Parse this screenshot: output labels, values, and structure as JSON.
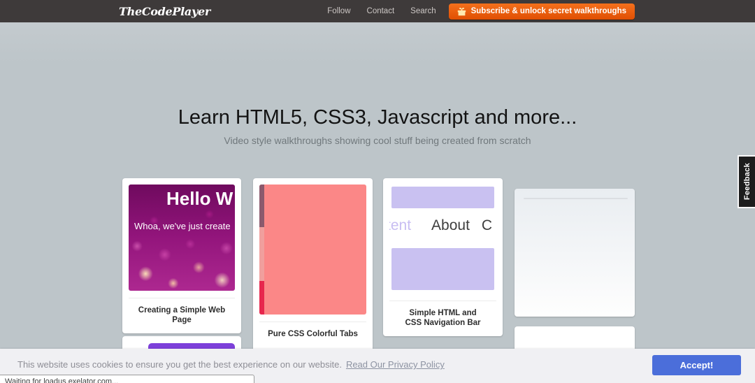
{
  "navbar": {
    "logo": "TheCodePlayer",
    "links": [
      {
        "label": "Follow"
      },
      {
        "label": "Contact"
      },
      {
        "label": "Search"
      }
    ],
    "subscribe_button": {
      "label": "Subscribe & unlock secret walkthroughs",
      "icon": "gift-icon",
      "color": "#ef5714"
    }
  },
  "hero": {
    "title": "Learn HTML5, CSS3, Javascript and more...",
    "subtitle": "Video style walkthroughs showing cool stuff being created from scratch"
  },
  "cards": [
    {
      "title": "Creating a Simple Web Page",
      "preview": {
        "heading": "Hello W",
        "subtext": "Whoa, we've just create"
      }
    },
    {
      "title": "Pure CSS Colorful Tabs",
      "preview": {
        "colors": {
          "main": "#fb8787",
          "strip_top": "#8b5a6d",
          "strip_mid": "#f09f9d",
          "strip_bottom": "#e7274e"
        }
      }
    },
    {
      "title": "Simple HTML and CSS Navigation Bar",
      "preview": {
        "nav_items": [
          "tent",
          "About",
          "C"
        ],
        "bar_color": "#c9c1f1"
      }
    },
    {
      "title": ""
    }
  ],
  "partial_cards": {
    "purple_bar_color": "#7d40da"
  },
  "feedback_tab": {
    "label": "Feedback"
  },
  "cookie_bar": {
    "message": "This website uses cookies to ensure you get the best experience on our website.",
    "link_label": "Read Our Privacy Policy",
    "accept_label": "Accept!",
    "accent_color": "#4b6eda"
  },
  "status_bar": {
    "text": "Waiting for loadus.exelator.com..."
  },
  "colors": {
    "navbar_bg": "#3e3a3a",
    "page_bg": "#bdc5c9",
    "subscribe_orange": "#ef5714",
    "accept_blue": "#4b6eda",
    "bokeh_magenta": "#93157c"
  }
}
